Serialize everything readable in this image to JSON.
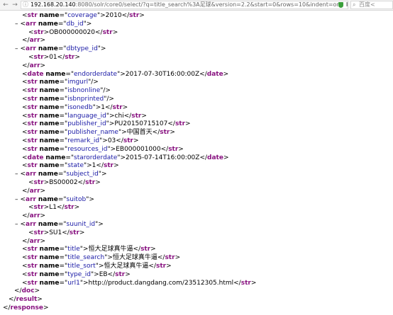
{
  "browser": {
    "url_host": "192.168.20.140",
    "url_rest": ":8080/solr/core0/select/?q=title_search%3A足球&version=2.2&start=0&rows=10&indent=on",
    "search_placeholder": "百度<",
    "shield_color": "#3a9f3a"
  },
  "xml": {
    "lines": [
      {
        "indent": 1,
        "c": [
          [
            "b",
            "<"
          ],
          [
            "t",
            "str"
          ],
          [
            "s",
            " "
          ],
          [
            "a",
            "name"
          ],
          [
            "b",
            "=\""
          ],
          [
            "v",
            "coverage"
          ],
          [
            "b",
            "\">2010</"
          ],
          [
            "t",
            "str"
          ],
          [
            "b",
            ">"
          ]
        ]
      },
      {
        "indent": 0,
        "minus": true,
        "c": [
          [
            "b",
            "<"
          ],
          [
            "t",
            "arr"
          ],
          [
            "s",
            " "
          ],
          [
            "a",
            "name"
          ],
          [
            "b",
            "=\""
          ],
          [
            "v",
            "db_id"
          ],
          [
            "b",
            "\">"
          ]
        ]
      },
      {
        "indent": 2,
        "c": [
          [
            "b",
            "<"
          ],
          [
            "t",
            "str"
          ],
          [
            "b",
            ">OB000000020</"
          ],
          [
            "t",
            "str"
          ],
          [
            "b",
            ">"
          ]
        ]
      },
      {
        "indent": 1,
        "c": [
          [
            "b",
            "</"
          ],
          [
            "t",
            "arr"
          ],
          [
            "b",
            ">"
          ]
        ]
      },
      {
        "indent": 0,
        "minus": true,
        "c": [
          [
            "b",
            "<"
          ],
          [
            "t",
            "arr"
          ],
          [
            "s",
            " "
          ],
          [
            "a",
            "name"
          ],
          [
            "b",
            "=\""
          ],
          [
            "v",
            "dbtype_id"
          ],
          [
            "b",
            "\">"
          ]
        ]
      },
      {
        "indent": 2,
        "c": [
          [
            "b",
            "<"
          ],
          [
            "t",
            "str"
          ],
          [
            "b",
            ">01</"
          ],
          [
            "t",
            "str"
          ],
          [
            "b",
            ">"
          ]
        ]
      },
      {
        "indent": 1,
        "c": [
          [
            "b",
            "</"
          ],
          [
            "t",
            "arr"
          ],
          [
            "b",
            ">"
          ]
        ]
      },
      {
        "indent": 1,
        "c": [
          [
            "b",
            "<"
          ],
          [
            "t",
            "date"
          ],
          [
            "s",
            " "
          ],
          [
            "a",
            "name"
          ],
          [
            "b",
            "=\""
          ],
          [
            "v",
            "endorderdate"
          ],
          [
            "b",
            "\">2017-07-30T16:00:00Z</"
          ],
          [
            "t",
            "date"
          ],
          [
            "b",
            ">"
          ]
        ]
      },
      {
        "indent": 1,
        "c": [
          [
            "b",
            "<"
          ],
          [
            "t",
            "str"
          ],
          [
            "s",
            " "
          ],
          [
            "a",
            "name"
          ],
          [
            "b",
            "=\""
          ],
          [
            "v",
            "imgurl"
          ],
          [
            "b",
            "\"/>"
          ]
        ]
      },
      {
        "indent": 1,
        "c": [
          [
            "b",
            "<"
          ],
          [
            "t",
            "str"
          ],
          [
            "s",
            " "
          ],
          [
            "a",
            "name"
          ],
          [
            "b",
            "=\""
          ],
          [
            "v",
            "isbnonline"
          ],
          [
            "b",
            "\"/>"
          ]
        ]
      },
      {
        "indent": 1,
        "c": [
          [
            "b",
            "<"
          ],
          [
            "t",
            "str"
          ],
          [
            "s",
            " "
          ],
          [
            "a",
            "name"
          ],
          [
            "b",
            "=\""
          ],
          [
            "v",
            "isbnprinted"
          ],
          [
            "b",
            "\"/>"
          ]
        ]
      },
      {
        "indent": 1,
        "c": [
          [
            "b",
            "<"
          ],
          [
            "t",
            "str"
          ],
          [
            "s",
            " "
          ],
          [
            "a",
            "name"
          ],
          [
            "b",
            "=\""
          ],
          [
            "v",
            "isonedb"
          ],
          [
            "b",
            "\">1</"
          ],
          [
            "t",
            "str"
          ],
          [
            "b",
            ">"
          ]
        ]
      },
      {
        "indent": 1,
        "c": [
          [
            "b",
            "<"
          ],
          [
            "t",
            "str"
          ],
          [
            "s",
            " "
          ],
          [
            "a",
            "name"
          ],
          [
            "b",
            "=\""
          ],
          [
            "v",
            "language_id"
          ],
          [
            "b",
            "\">chi</"
          ],
          [
            "t",
            "str"
          ],
          [
            "b",
            ">"
          ]
        ]
      },
      {
        "indent": 1,
        "c": [
          [
            "b",
            "<"
          ],
          [
            "t",
            "str"
          ],
          [
            "s",
            " "
          ],
          [
            "a",
            "name"
          ],
          [
            "b",
            "=\""
          ],
          [
            "v",
            "publisher_id"
          ],
          [
            "b",
            "\">PU20150715107</"
          ],
          [
            "t",
            "str"
          ],
          [
            "b",
            ">"
          ]
        ]
      },
      {
        "indent": 1,
        "c": [
          [
            "b",
            "<"
          ],
          [
            "t",
            "str"
          ],
          [
            "s",
            " "
          ],
          [
            "a",
            "name"
          ],
          [
            "b",
            "=\""
          ],
          [
            "v",
            "publisher_name"
          ],
          [
            "b",
            "\">中国首天</"
          ],
          [
            "t",
            "str"
          ],
          [
            "b",
            ">"
          ]
        ]
      },
      {
        "indent": 1,
        "c": [
          [
            "b",
            "<"
          ],
          [
            "t",
            "str"
          ],
          [
            "s",
            " "
          ],
          [
            "a",
            "name"
          ],
          [
            "b",
            "=\""
          ],
          [
            "v",
            "remark_id"
          ],
          [
            "b",
            "\">03</"
          ],
          [
            "t",
            "str"
          ],
          [
            "b",
            ">"
          ]
        ]
      },
      {
        "indent": 1,
        "c": [
          [
            "b",
            "<"
          ],
          [
            "t",
            "str"
          ],
          [
            "s",
            " "
          ],
          [
            "a",
            "name"
          ],
          [
            "b",
            "=\""
          ],
          [
            "v",
            "resources_id"
          ],
          [
            "b",
            "\">EB000001000</"
          ],
          [
            "t",
            "str"
          ],
          [
            "b",
            ">"
          ]
        ]
      },
      {
        "indent": 1,
        "c": [
          [
            "b",
            "<"
          ],
          [
            "t",
            "date"
          ],
          [
            "s",
            " "
          ],
          [
            "a",
            "name"
          ],
          [
            "b",
            "=\""
          ],
          [
            "v",
            "starorderdate"
          ],
          [
            "b",
            "\">2015-07-14T16:00:00Z</"
          ],
          [
            "t",
            "date"
          ],
          [
            "b",
            ">"
          ]
        ]
      },
      {
        "indent": 1,
        "c": [
          [
            "b",
            "<"
          ],
          [
            "t",
            "str"
          ],
          [
            "s",
            " "
          ],
          [
            "a",
            "name"
          ],
          [
            "b",
            "=\""
          ],
          [
            "v",
            "state"
          ],
          [
            "b",
            "\">1</"
          ],
          [
            "t",
            "str"
          ],
          [
            "b",
            ">"
          ]
        ]
      },
      {
        "indent": 0,
        "minus": true,
        "c": [
          [
            "b",
            "<"
          ],
          [
            "t",
            "arr"
          ],
          [
            "s",
            " "
          ],
          [
            "a",
            "name"
          ],
          [
            "b",
            "=\""
          ],
          [
            "v",
            "subject_id"
          ],
          [
            "b",
            "\">"
          ]
        ]
      },
      {
        "indent": 2,
        "c": [
          [
            "b",
            "<"
          ],
          [
            "t",
            "str"
          ],
          [
            "b",
            ">BS00002</"
          ],
          [
            "t",
            "str"
          ],
          [
            "b",
            ">"
          ]
        ]
      },
      {
        "indent": 1,
        "c": [
          [
            "b",
            "</"
          ],
          [
            "t",
            "arr"
          ],
          [
            "b",
            ">"
          ]
        ]
      },
      {
        "indent": 0,
        "minus": true,
        "c": [
          [
            "b",
            "<"
          ],
          [
            "t",
            "arr"
          ],
          [
            "s",
            " "
          ],
          [
            "a",
            "name"
          ],
          [
            "b",
            "=\""
          ],
          [
            "v",
            "suitob"
          ],
          [
            "b",
            "\">"
          ]
        ]
      },
      {
        "indent": 2,
        "c": [
          [
            "b",
            "<"
          ],
          [
            "t",
            "str"
          ],
          [
            "b",
            ">L1</"
          ],
          [
            "t",
            "str"
          ],
          [
            "b",
            ">"
          ]
        ]
      },
      {
        "indent": 1,
        "c": [
          [
            "b",
            "</"
          ],
          [
            "t",
            "arr"
          ],
          [
            "b",
            ">"
          ]
        ]
      },
      {
        "indent": 0,
        "minus": true,
        "c": [
          [
            "b",
            "<"
          ],
          [
            "t",
            "arr"
          ],
          [
            "s",
            " "
          ],
          [
            "a",
            "name"
          ],
          [
            "b",
            "=\""
          ],
          [
            "v",
            "suunit_id"
          ],
          [
            "b",
            "\">"
          ]
        ]
      },
      {
        "indent": 2,
        "c": [
          [
            "b",
            "<"
          ],
          [
            "t",
            "str"
          ],
          [
            "b",
            ">SU1</"
          ],
          [
            "t",
            "str"
          ],
          [
            "b",
            ">"
          ]
        ]
      },
      {
        "indent": 1,
        "c": [
          [
            "b",
            "</"
          ],
          [
            "t",
            "arr"
          ],
          [
            "b",
            ">"
          ]
        ]
      },
      {
        "indent": 1,
        "c": [
          [
            "b",
            "<"
          ],
          [
            "t",
            "str"
          ],
          [
            "s",
            " "
          ],
          [
            "a",
            "name"
          ],
          [
            "b",
            "=\""
          ],
          [
            "v",
            "title"
          ],
          [
            "b",
            "\">恒大足球真牛逼</"
          ],
          [
            "t",
            "str"
          ],
          [
            "b",
            ">"
          ]
        ]
      },
      {
        "indent": 1,
        "c": [
          [
            "b",
            "<"
          ],
          [
            "t",
            "str"
          ],
          [
            "s",
            " "
          ],
          [
            "a",
            "name"
          ],
          [
            "b",
            "=\""
          ],
          [
            "v",
            "title_search"
          ],
          [
            "b",
            "\">恒大足球真牛逼</"
          ],
          [
            "t",
            "str"
          ],
          [
            "b",
            ">"
          ]
        ]
      },
      {
        "indent": 1,
        "c": [
          [
            "b",
            "<"
          ],
          [
            "t",
            "str"
          ],
          [
            "s",
            " "
          ],
          [
            "a",
            "name"
          ],
          [
            "b",
            "=\""
          ],
          [
            "v",
            "title_sort"
          ],
          [
            "b",
            "\">恒大足球真牛逼</"
          ],
          [
            "t",
            "str"
          ],
          [
            "b",
            ">"
          ]
        ]
      },
      {
        "indent": 1,
        "c": [
          [
            "b",
            "<"
          ],
          [
            "t",
            "str"
          ],
          [
            "s",
            " "
          ],
          [
            "a",
            "name"
          ],
          [
            "b",
            "=\""
          ],
          [
            "v",
            "type_id"
          ],
          [
            "b",
            "\">EB</"
          ],
          [
            "t",
            "str"
          ],
          [
            "b",
            ">"
          ]
        ]
      },
      {
        "indent": 1,
        "c": [
          [
            "b",
            "<"
          ],
          [
            "t",
            "str"
          ],
          [
            "s",
            " "
          ],
          [
            "a",
            "name"
          ],
          [
            "b",
            "=\""
          ],
          [
            "v",
            "url1"
          ],
          [
            "b",
            "\">http://product.dangdang.com/23512305.html</"
          ],
          [
            "t",
            "str"
          ],
          [
            "b",
            ">"
          ]
        ]
      },
      {
        "indent": 3,
        "c": [
          [
            "b",
            "</"
          ],
          [
            "t",
            "doc"
          ],
          [
            "b",
            ">"
          ]
        ]
      },
      {
        "indent": 4,
        "c": [
          [
            "b",
            "</"
          ],
          [
            "t",
            "result"
          ],
          [
            "b",
            ">"
          ]
        ]
      },
      {
        "indent": 5,
        "c": [
          [
            "b",
            "</"
          ],
          [
            "t",
            "response"
          ],
          [
            "b",
            ">"
          ]
        ]
      }
    ]
  }
}
